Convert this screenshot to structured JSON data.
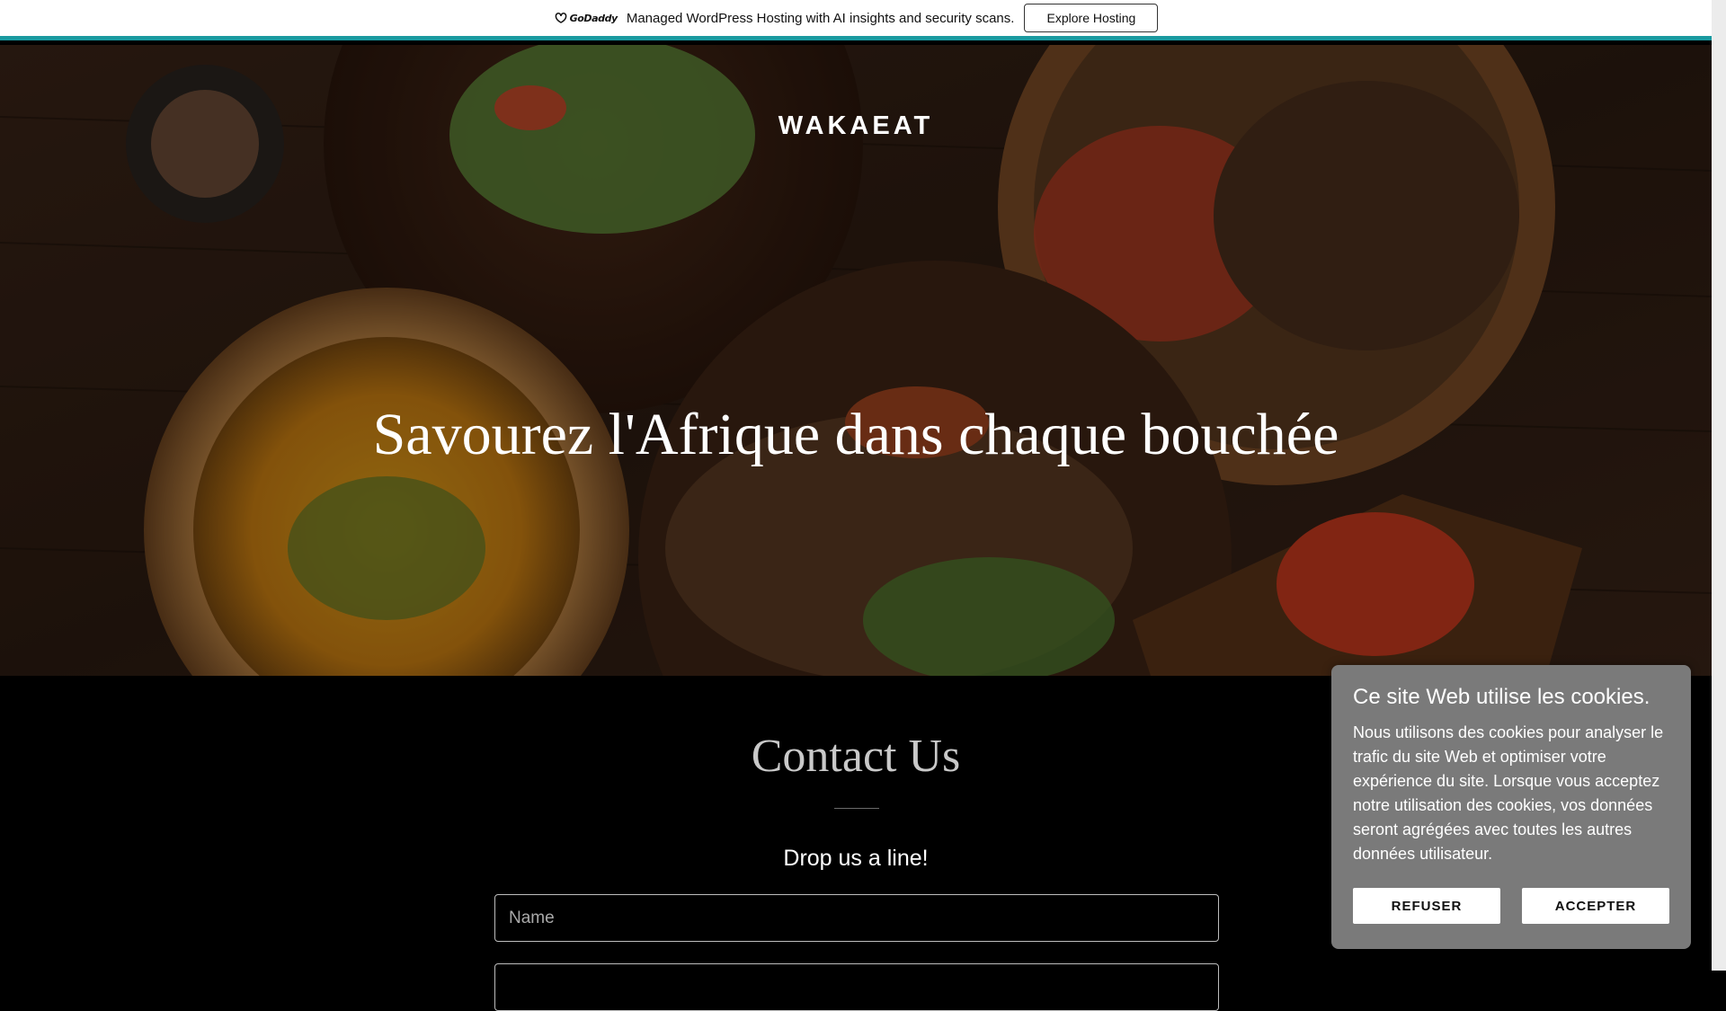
{
  "promo": {
    "logo_text": "GoDaddy",
    "message": "Managed WordPress Hosting with AI insights and security scans.",
    "button_label": "Explore Hosting"
  },
  "header": {
    "brand": "WAKAEAT"
  },
  "hero": {
    "headline": "Savourez l'Afrique dans chaque bouchée"
  },
  "contact": {
    "title": "Contact Us",
    "subtitle": "Drop us a line!",
    "name_placeholder": "Name",
    "next_placeholder": ""
  },
  "cookie_banner": {
    "title": "Ce site Web utilise les cookies.",
    "body": "Nous utilisons des cookies pour analyser le trafic du site Web et optimiser votre expérience du site. Lorsque vous acceptez notre utilisation des cookies, vos données seront agrégées avec toutes les autres données utilisateur.",
    "refuse_label": "REFUSER",
    "accept_label": "ACCEPTER"
  },
  "colors": {
    "accent_bar": "#1a9aa0",
    "cookie_panel": "#7a7a7a",
    "page_background": "#000000"
  }
}
